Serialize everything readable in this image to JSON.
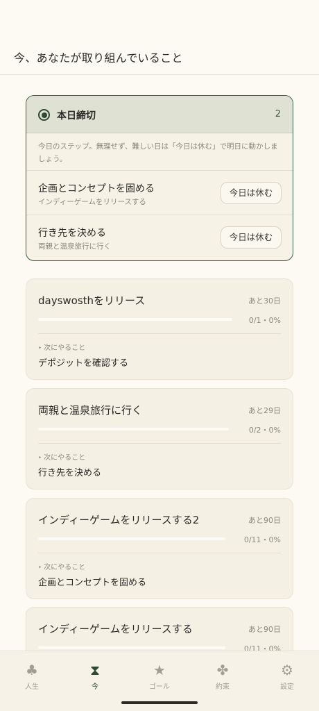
{
  "header": {
    "title": "今、あなたが取り組んでいること"
  },
  "today": {
    "title": "本日締切",
    "count": "2",
    "note": "今日のステップ。無理せず、難しい日は「今日は休む」で明日に動かしましょう。",
    "tasks": [
      {
        "name": "企画とコンセプトを固める",
        "goal": "インディーゲームをリリースする",
        "button": "今日は休む"
      },
      {
        "name": "行き先を決める",
        "goal": "両親と温泉旅行に行く",
        "button": "今日は休む"
      }
    ]
  },
  "goals": [
    {
      "title": "dayswosthをリリース",
      "remaining": "あと30日",
      "progress_text": "0/1・0%",
      "progress": 0,
      "next_label": "次にやること",
      "next": "デポジットを確認する"
    },
    {
      "title": "両親と温泉旅行に行く",
      "remaining": "あと29日",
      "progress_text": "0/2・0%",
      "progress": 0,
      "next_label": "次にやること",
      "next": "行き先を決める"
    },
    {
      "title": "インディーゲームをリリースする2",
      "remaining": "あと90日",
      "progress_text": "0/11・0%",
      "progress": 0,
      "next_label": "次にやること",
      "next": "企画とコンセプトを固める"
    },
    {
      "title": "インディーゲームをリリースする",
      "remaining": "あと90日",
      "progress_text": "0/11・0%",
      "progress": 0
    }
  ],
  "nav": [
    {
      "label": "人生",
      "icon": "club-icon",
      "glyph": "♣",
      "active": false
    },
    {
      "label": "今",
      "icon": "hourglass-icon",
      "glyph": "⧗",
      "active": true
    },
    {
      "label": "ゴール",
      "icon": "star-icon",
      "glyph": "★",
      "active": false
    },
    {
      "label": "約束",
      "icon": "clover-icon",
      "glyph": "✤",
      "active": false
    },
    {
      "label": "設定",
      "icon": "gear-icon",
      "glyph": "⚙",
      "active": false
    }
  ],
  "colors": {
    "accent": "#2f4a37",
    "background": "#fcfaf3",
    "card": "#f4f0e4"
  }
}
